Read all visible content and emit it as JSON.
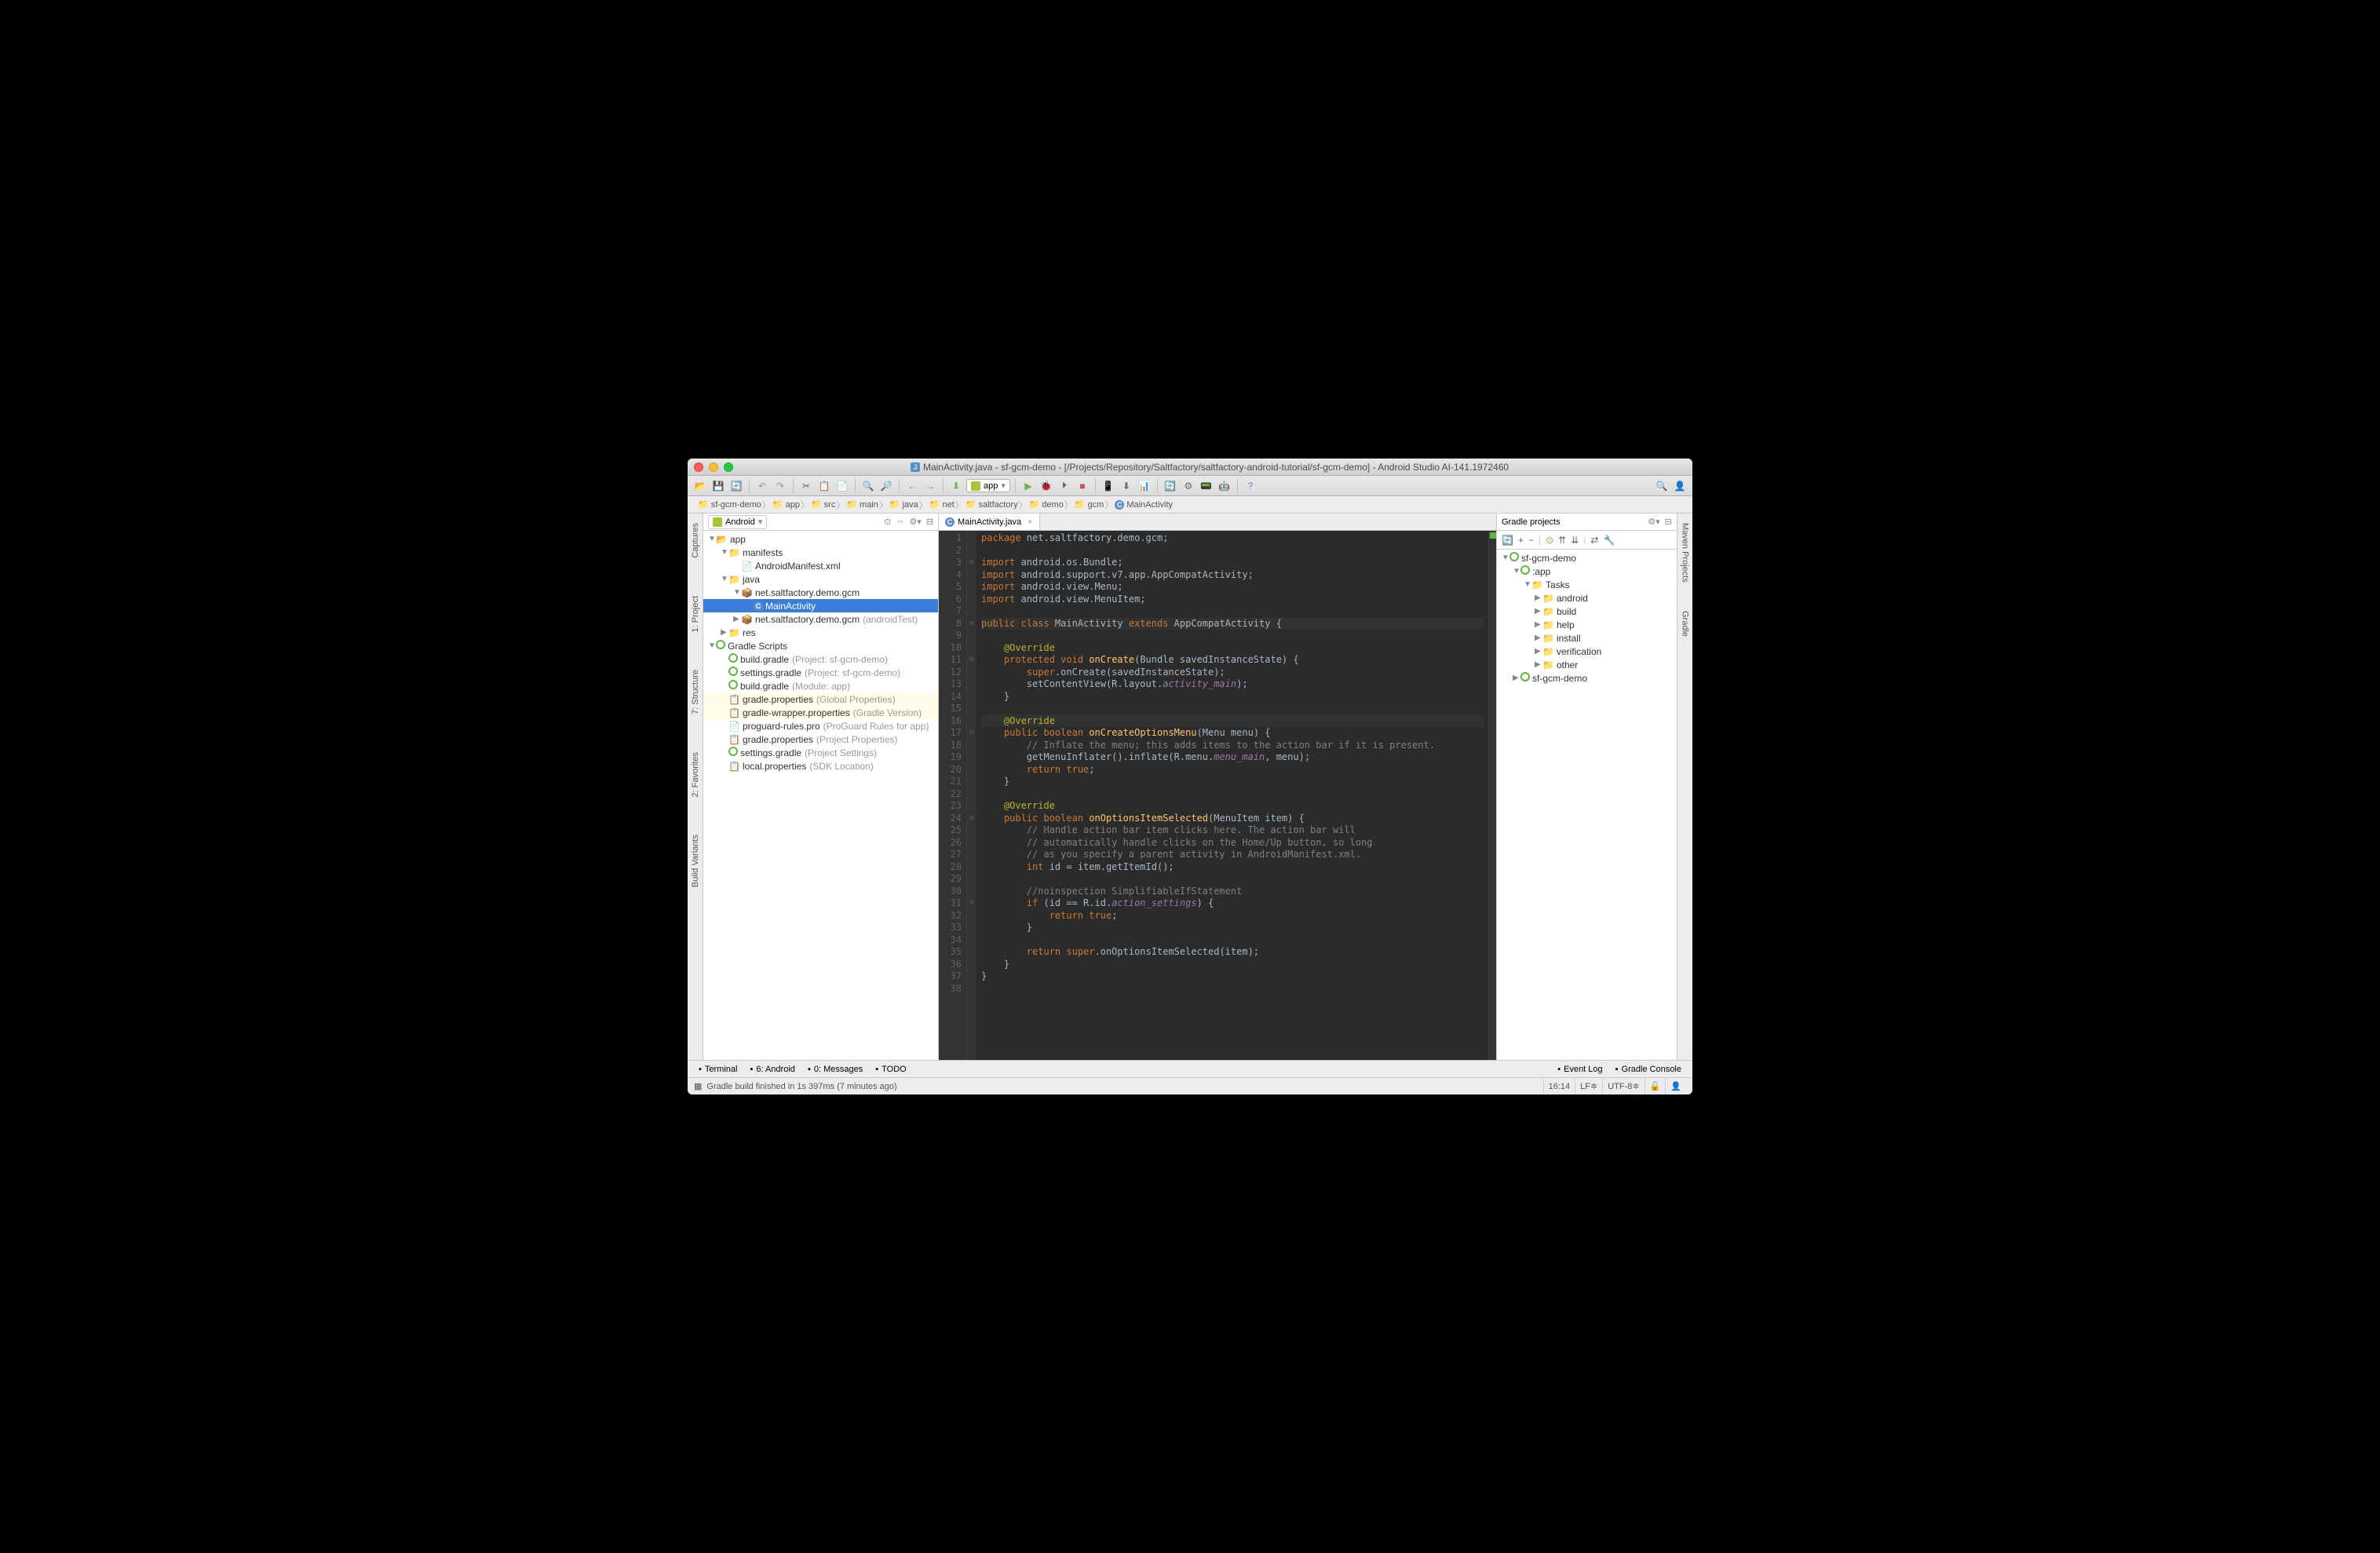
{
  "window": {
    "title": "MainActivity.java - sf-gcm-demo - [/Projects/Repository/Saltfactory/saltfactory-android-tutorial/sf-gcm-demo] - Android Studio AI-141.1972460"
  },
  "toolbar": {
    "module_selector": "app"
  },
  "breadcrumb": [
    "sf-gcm-demo",
    "app",
    "src",
    "main",
    "java",
    "net",
    "saltfactory",
    "demo",
    "gcm",
    "MainActivity"
  ],
  "left_gutter": [
    "Captures",
    "1: Project",
    "7: Structure",
    "2: Favorites",
    "Build Variants"
  ],
  "right_gutter": [
    "Maven Projects",
    "Gradle"
  ],
  "sidebar": {
    "view": "Android",
    "tree": [
      {
        "d": 0,
        "arrow": "▼",
        "icon": "folder-app",
        "label": "app"
      },
      {
        "d": 1,
        "arrow": "▼",
        "icon": "folder",
        "label": "manifests"
      },
      {
        "d": 2,
        "arrow": "",
        "icon": "xml",
        "label": "AndroidManifest.xml"
      },
      {
        "d": 1,
        "arrow": "▼",
        "icon": "folder",
        "label": "java"
      },
      {
        "d": 2,
        "arrow": "▼",
        "icon": "pkg",
        "label": "net.saltfactory.demo.gcm"
      },
      {
        "d": 3,
        "arrow": "",
        "icon": "class",
        "label": "MainActivity",
        "selected": true
      },
      {
        "d": 2,
        "arrow": "▶",
        "icon": "pkg",
        "label": "net.saltfactory.demo.gcm",
        "hint": "(androidTest)"
      },
      {
        "d": 1,
        "arrow": "▶",
        "icon": "folder",
        "label": "res"
      },
      {
        "d": 0,
        "arrow": "▼",
        "icon": "gradle",
        "label": "Gradle Scripts"
      },
      {
        "d": 1,
        "arrow": "",
        "icon": "gradle-f",
        "label": "build.gradle",
        "hint": "(Project: sf-gcm-demo)"
      },
      {
        "d": 1,
        "arrow": "",
        "icon": "gradle-f",
        "label": "settings.gradle",
        "hint": "(Project: sf-gcm-demo)"
      },
      {
        "d": 1,
        "arrow": "",
        "icon": "gradle-f",
        "label": "build.gradle",
        "hint": "(Module: app)"
      },
      {
        "d": 1,
        "arrow": "",
        "icon": "props",
        "label": "gradle.properties",
        "hint": "(Global Properties)",
        "bg": true
      },
      {
        "d": 1,
        "arrow": "",
        "icon": "props",
        "label": "gradle-wrapper.properties",
        "hint": "(Gradle Version)",
        "bg": true
      },
      {
        "d": 1,
        "arrow": "",
        "icon": "txt",
        "label": "proguard-rules.pro",
        "hint": "(ProGuard Rules for app)"
      },
      {
        "d": 1,
        "arrow": "",
        "icon": "props",
        "label": "gradle.properties",
        "hint": "(Project Properties)"
      },
      {
        "d": 1,
        "arrow": "",
        "icon": "gradle-f",
        "label": "settings.gradle",
        "hint": "(Project Settings)"
      },
      {
        "d": 1,
        "arrow": "",
        "icon": "props",
        "label": "local.properties",
        "hint": "(SDK Location)"
      }
    ]
  },
  "editor": {
    "tab": "MainActivity.java",
    "lines": [
      {
        "n": 1,
        "html": "<span class='kw'>package</span> net.saltfactory.demo.gcm;"
      },
      {
        "n": 2,
        "html": ""
      },
      {
        "n": 3,
        "html": "<span class='kw'>import</span> android.os.Bundle;"
      },
      {
        "n": 4,
        "html": "<span class='kw'>import</span> android.support.v7.app.AppCompatActivity;"
      },
      {
        "n": 5,
        "html": "<span class='kw'>import</span> android.view.Menu;"
      },
      {
        "n": 6,
        "html": "<span class='kw'>import</span> android.view.MenuItem;"
      },
      {
        "n": 7,
        "html": ""
      },
      {
        "n": 8,
        "html": "<span class='kw'>public class</span> MainActivity <span class='kw'>extends</span> AppCompatActivity {",
        "hl": true
      },
      {
        "n": 9,
        "html": ""
      },
      {
        "n": 10,
        "html": "    <span class='ann'>@Override</span>"
      },
      {
        "n": 11,
        "html": "    <span class='kw'>protected void</span> <span class='fn'>onCreate</span>(Bundle savedInstanceState) {"
      },
      {
        "n": 12,
        "html": "        <span class='kw'>super</span>.onCreate(savedInstanceState);"
      },
      {
        "n": 13,
        "html": "        setContentView(R.layout.<span class='field'>activity_main</span>);"
      },
      {
        "n": 14,
        "html": "    }"
      },
      {
        "n": 15,
        "html": ""
      },
      {
        "n": 16,
        "html": "    <span class='ann'>@Override</span>",
        "caret": true
      },
      {
        "n": 17,
        "html": "    <span class='kw'>public boolean</span> <span class='fn'>onCreateOptionsMenu</span>(Menu menu) {"
      },
      {
        "n": 18,
        "html": "        <span class='cmt'>// Inflate the menu; this adds items to the action bar if it is present.</span>"
      },
      {
        "n": 19,
        "html": "        getMenuInflater().inflate(R.menu.<span class='field'>menu_main</span>, menu);"
      },
      {
        "n": 20,
        "html": "        <span class='kw'>return true</span>;"
      },
      {
        "n": 21,
        "html": "    }"
      },
      {
        "n": 22,
        "html": ""
      },
      {
        "n": 23,
        "html": "    <span class='ann'>@Override</span>"
      },
      {
        "n": 24,
        "html": "    <span class='kw'>public boolean</span> <span class='fn'>onOptionsItemSelected</span>(MenuItem item) {"
      },
      {
        "n": 25,
        "html": "        <span class='cmt'>// Handle action bar item clicks here. The action bar will</span>"
      },
      {
        "n": 26,
        "html": "        <span class='cmt'>// automatically handle clicks on the Home/Up button, so long</span>"
      },
      {
        "n": 27,
        "html": "        <span class='cmt'>// as you specify a parent activity in AndroidManifest.xml.</span>"
      },
      {
        "n": 28,
        "html": "        <span class='kw'>int</span> id = item.getItemId();"
      },
      {
        "n": 29,
        "html": ""
      },
      {
        "n": 30,
        "html": "        <span class='cmt'>//noinspection SimplifiableIfStatement</span>"
      },
      {
        "n": 31,
        "html": "        <span class='kw'>if</span> (id == R.id.<span class='field'>action_settings</span>) {"
      },
      {
        "n": 32,
        "html": "            <span class='kw'>return true</span>;"
      },
      {
        "n": 33,
        "html": "        }"
      },
      {
        "n": 34,
        "html": ""
      },
      {
        "n": 35,
        "html": "        <span class='kw'>return super</span>.onOptionsItemSelected(item);"
      },
      {
        "n": 36,
        "html": "    }"
      },
      {
        "n": 37,
        "html": "}"
      },
      {
        "n": 38,
        "html": ""
      }
    ]
  },
  "gradle_panel": {
    "title": "Gradle projects",
    "tree": [
      {
        "d": 0,
        "arrow": "▼",
        "icon": "gradle",
        "label": "sf-gcm-demo"
      },
      {
        "d": 1,
        "arrow": "▼",
        "icon": "gradle",
        "label": ":app"
      },
      {
        "d": 2,
        "arrow": "▼",
        "icon": "folder-t",
        "label": "Tasks"
      },
      {
        "d": 3,
        "arrow": "▶",
        "icon": "folder-t",
        "label": "android"
      },
      {
        "d": 3,
        "arrow": "▶",
        "icon": "folder-t",
        "label": "build"
      },
      {
        "d": 3,
        "arrow": "▶",
        "icon": "folder-t",
        "label": "help"
      },
      {
        "d": 3,
        "arrow": "▶",
        "icon": "folder-t",
        "label": "install"
      },
      {
        "d": 3,
        "arrow": "▶",
        "icon": "folder-t",
        "label": "verification"
      },
      {
        "d": 3,
        "arrow": "▶",
        "icon": "folder-t",
        "label": "other"
      },
      {
        "d": 1,
        "arrow": "▶",
        "icon": "gradle",
        "label": "sf-gcm-demo"
      }
    ]
  },
  "bottom_tabs": {
    "left": [
      "Terminal",
      "6: Android",
      "0: Messages",
      "TODO"
    ],
    "right": [
      "Event Log",
      "Gradle Console"
    ]
  },
  "statusbar": {
    "message": "Gradle build finished in 1s 397ms (7 minutes ago)",
    "position": "16:14",
    "linesep": "LF≑",
    "encoding": "UTF-8≑"
  }
}
